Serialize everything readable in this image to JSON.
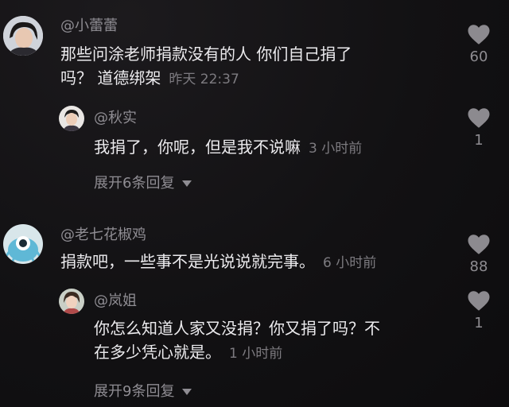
{
  "comments": [
    {
      "username": "@小蕾蕾",
      "line1": "那些问涂老师捐款没有的人 你们自己捐了",
      "line2": "吗？ 道德绑架",
      "time": "昨天 22:37",
      "likes": "60",
      "reply": {
        "username": "@秋实",
        "text": "我捐了，你呢，但是我不说嘛",
        "time": "3 小时前",
        "likes": "1"
      },
      "expand_label": "展开6条回复"
    },
    {
      "username": "@老七花椒鸡",
      "line1": "捐款吧，一些事不是光说说就完事。",
      "time": "6 小时前",
      "likes": "88",
      "reply": {
        "username": "@岚姐",
        "line1": "你怎么知道人家又没捐？你又捐了吗？不",
        "line2": "在多少凭心就是。",
        "time": "1 小时前",
        "likes": "1"
      },
      "expand_label": "展开9条回复"
    }
  ]
}
